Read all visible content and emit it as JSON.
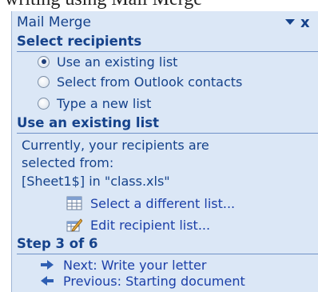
{
  "backdrop": {
    "cut_text": "writing using Mail Merge"
  },
  "pane": {
    "title": "Mail Merge",
    "dropdown_icon": "chevron-down-icon",
    "close_icon": "close-icon",
    "close_glyph": "x"
  },
  "select_recipients": {
    "heading": "Select recipients",
    "options": [
      {
        "label": "Use an existing list",
        "checked": true
      },
      {
        "label": "Select from Outlook contacts",
        "checked": false
      },
      {
        "label": "Type a new list",
        "checked": false
      }
    ]
  },
  "existing_list": {
    "heading": "Use an existing list",
    "description_lines": [
      "Currently, your recipients are",
      "selected from:",
      "[Sheet1$] in \"class.xls\""
    ],
    "links": [
      {
        "label": "Select a different list...",
        "icon": "table-icon"
      },
      {
        "label": "Edit recipient list...",
        "icon": "edit-list-icon"
      }
    ]
  },
  "step": {
    "heading": "Step 3 of 6",
    "next_label": "Next: Write your letter",
    "previous_label": "Previous: Starting document"
  },
  "colors": {
    "pane_bg": "#dbe7f6",
    "heading": "#15428b",
    "link": "#1b3fa8",
    "arrow": "#2f5fb3"
  }
}
